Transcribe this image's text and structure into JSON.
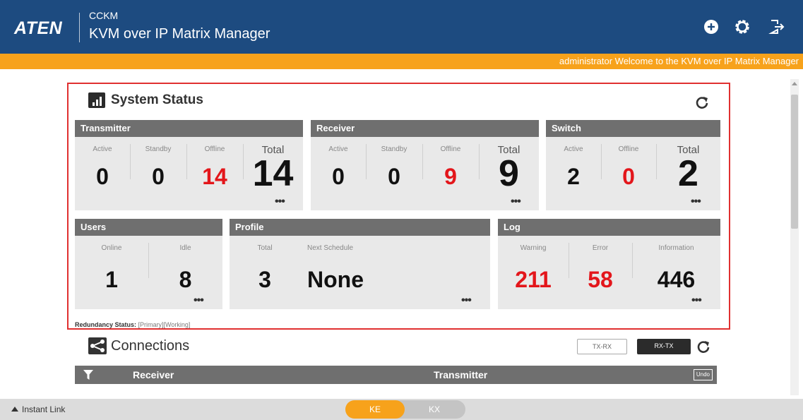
{
  "header": {
    "logo": "ATEN",
    "subtitle": "CCKM",
    "title": "KVM over IP Matrix Manager",
    "icons": [
      "add-icon",
      "gear-icon",
      "logout-icon"
    ]
  },
  "welcome_text": "administrator Welcome to the KVM over IP Matrix Manager",
  "system_status": {
    "title": "System Status",
    "transmitter": {
      "label": "Transmitter",
      "active_label": "Active",
      "active": "0",
      "standby_label": "Standby",
      "standby": "0",
      "offline_label": "Offline",
      "offline": "14",
      "total_label": "Total",
      "total": "14"
    },
    "receiver": {
      "label": "Receiver",
      "active_label": "Active",
      "active": "0",
      "standby_label": "Standby",
      "standby": "0",
      "offline_label": "Offline",
      "offline": "9",
      "total_label": "Total",
      "total": "9"
    },
    "switch": {
      "label": "Switch",
      "active_label": "Active",
      "active": "2",
      "offline_label": "Offline",
      "offline": "0",
      "total_label": "Total",
      "total": "2"
    },
    "users": {
      "label": "Users",
      "online_label": "Online",
      "online": "1",
      "idle_label": "Idle",
      "idle": "8"
    },
    "profile": {
      "label": "Profile",
      "total_label": "Total",
      "total": "3",
      "next_schedule_label": "Next Schedule",
      "next_schedule": "None"
    },
    "log": {
      "label": "Log",
      "warning_label": "Warning",
      "warning": "211",
      "error_label": "Error",
      "error": "58",
      "information_label": "Information",
      "information": "446"
    },
    "more": "•••",
    "redundancy_label": "Redundancy Status:",
    "redundancy_primary": "[Primary]",
    "redundancy_working": "[Working]"
  },
  "connections": {
    "title": "Connections",
    "tx_rx": "TX-RX",
    "rx_tx": "RX-TX",
    "col_receiver": "Receiver",
    "col_transmitter": "Transmitter",
    "undo": "Undo"
  },
  "bottom": {
    "instant_link": "Instant Link",
    "mode_ke": "KE",
    "mode_kx": "KX"
  },
  "colors": {
    "header": "#1d4b80",
    "accent": "#f7a21b",
    "alert": "#e3161b",
    "panel_head": "#6f6f6f"
  }
}
